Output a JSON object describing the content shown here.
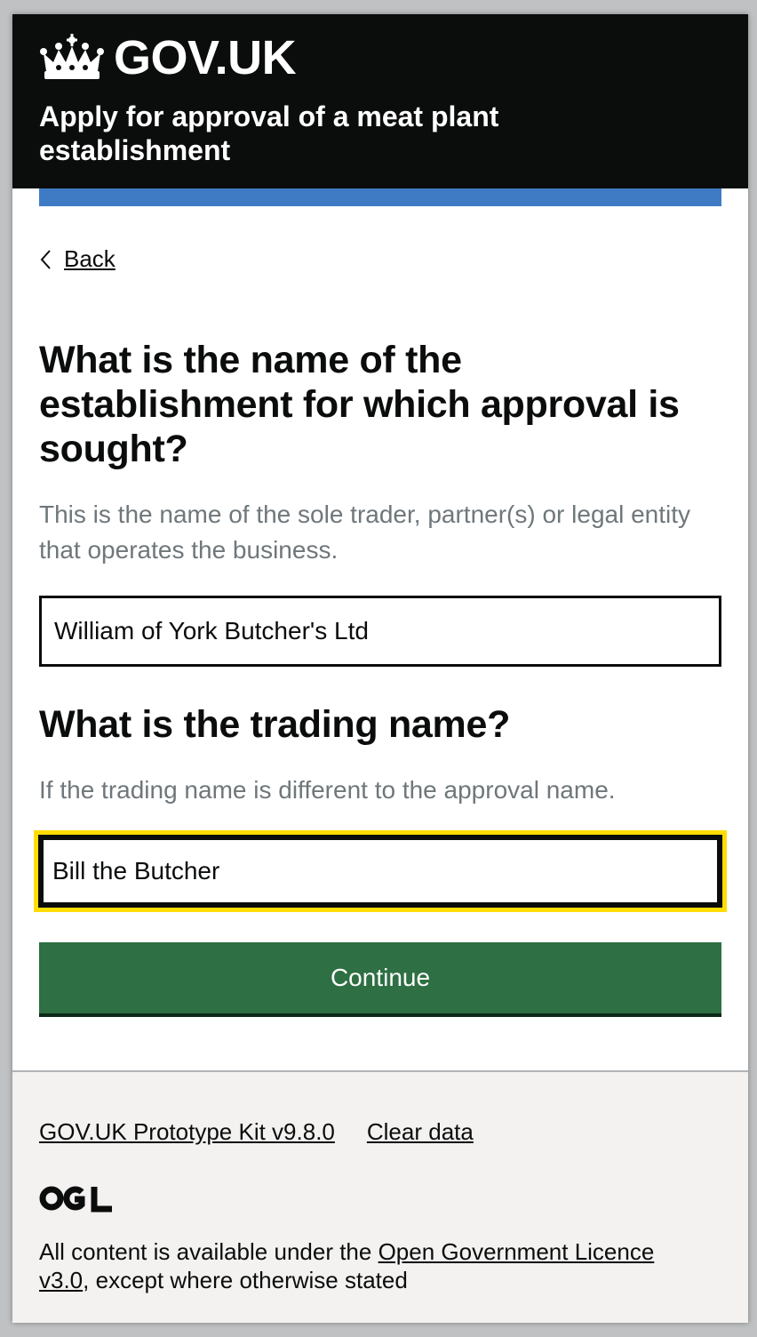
{
  "header": {
    "brand": "GOV.UK",
    "service_name": "Apply for approval of a meat plant establishment",
    "accent_color": "#3f7bc4"
  },
  "nav": {
    "back_label": "Back"
  },
  "form": {
    "establishment": {
      "question": "What is the name of the establishment for which approval is sought?",
      "hint": "This is the name of the sole trader, partner(s) or legal entity that operates the business.",
      "value": "William of York Butcher's Ltd"
    },
    "trading": {
      "question": "What is the trading name?",
      "hint": "If the trading name is different to the approval name.",
      "value": "Bill the Butcher"
    },
    "continue_label": "Continue",
    "button_color": "#2e6f43",
    "focus_color": "#ffdd00"
  },
  "footer": {
    "kit_link": "GOV.UK Prototype Kit v9.8.0",
    "clear_link": "Clear data",
    "logo": "OGL",
    "licence_prefix": "All content is available under the ",
    "licence_link": "Open Government Licence v3.0",
    "licence_suffix": ", except where otherwise stated"
  },
  "icons": {
    "crown": "crown-icon",
    "back": "chevron-left-icon",
    "ogl": "ogl-logo-icon"
  }
}
